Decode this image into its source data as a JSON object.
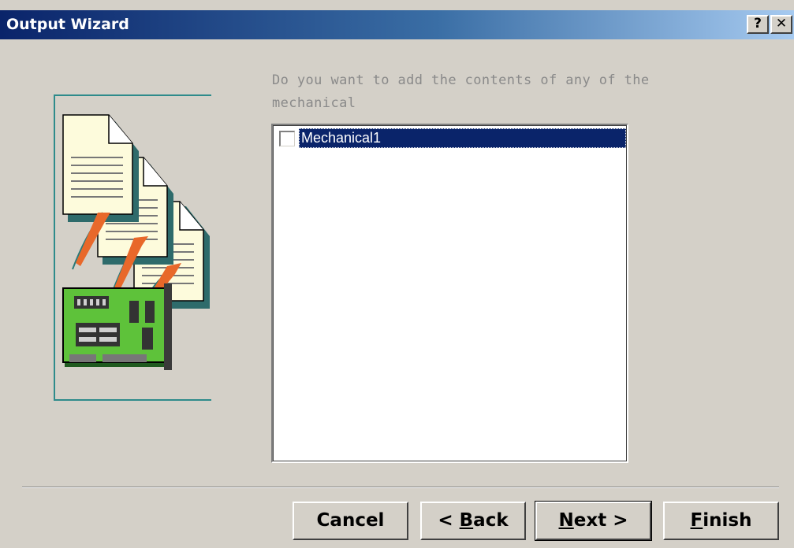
{
  "window": {
    "title": "Output Wizard",
    "help_label": "?",
    "close_label": "✕"
  },
  "prompt": {
    "line1": "Do you want to add the contents of any of the",
    "line2": "mechanical"
  },
  "layers": {
    "items": [
      {
        "label": "Mechanical1",
        "checked": false,
        "selected": true
      }
    ]
  },
  "buttons": {
    "cancel": "Cancel",
    "back_prefix": "< ",
    "back_mnemonic": "B",
    "back_rest": "ack",
    "next_mnemonic": "N",
    "next_rest": "ext >",
    "finish_mnemonic": "F",
    "finish_rest": "inish"
  },
  "colors": {
    "title_start": "#0a246a",
    "title_end": "#a6caf0",
    "selection": "#0a246a",
    "dialog": "#d4d0c8",
    "illustration_frame": "#2e8b8b",
    "board": "#5ec23a",
    "arrow": "#e8682a",
    "document": "#fdfbdc"
  },
  "illustration": {
    "name": "documents-from-circuit-board"
  }
}
